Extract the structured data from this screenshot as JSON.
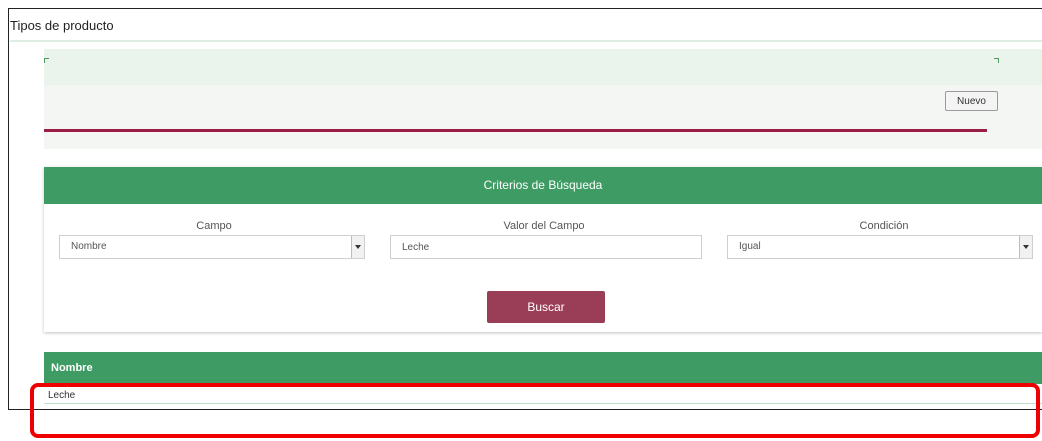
{
  "page": {
    "title": "Tipos de producto"
  },
  "toolbar": {
    "new_label": "Nuevo"
  },
  "search": {
    "header": "Criterios de Búsqueda",
    "field": {
      "label": "Campo",
      "selected": "Nombre"
    },
    "value": {
      "label": "Valor del Campo",
      "current": "Leche"
    },
    "condition": {
      "label": "Condición",
      "selected": "Igual"
    },
    "submit_label": "Buscar"
  },
  "results": {
    "columns": [
      "Nombre"
    ],
    "rows": [
      [
        "Leche"
      ]
    ]
  },
  "colors": {
    "accent_green": "#3d9b63",
    "accent_maroon": "#9a3e57",
    "rule_maroon": "#9a1d44",
    "highlight_red": "#ee0000"
  },
  "icons": {
    "select_arrow": "chevron-down-icon",
    "panel_corners": "corner-bracket-icon"
  }
}
